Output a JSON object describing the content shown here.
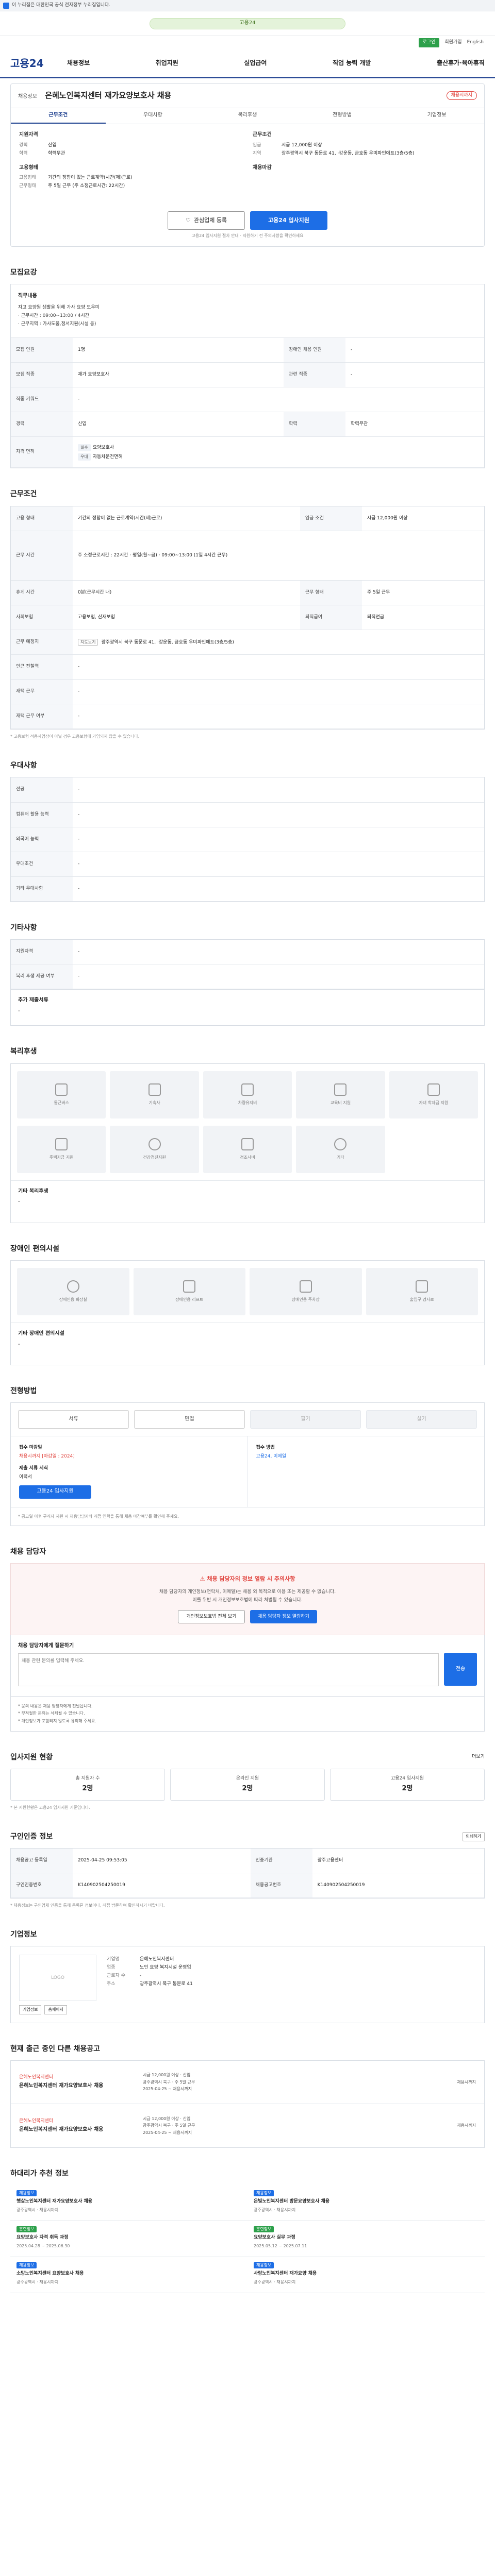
{
  "topbar": {
    "notice": "이 누리집은 대한민국 공식 전자정부 누리집입니다."
  },
  "banner": {
    "text": "고용24"
  },
  "util": {
    "login": "로그인",
    "join": "회원가입",
    "lang": "English"
  },
  "gnb": {
    "logo": "고용24",
    "menu": [
      "채용정보",
      "취업지원",
      "실업급여",
      "직업 능력 개발",
      "출산휴가·육아휴직"
    ]
  },
  "posting": {
    "org": "채용정보",
    "title": "은혜노인복지센터 재가요양보호사 채용",
    "badge": "채용시까지",
    "tabs": [
      "근무조건",
      "우대사항",
      "복리후생",
      "전형방법",
      "기업정보"
    ],
    "summary": {
      "left": [
        {
          "h": "지원자격",
          "rows": [
            [
              "경력",
              "신입"
            ],
            [
              "학력",
              "학력무관"
            ]
          ]
        },
        {
          "h": "고용형태",
          "rows": [
            [
              "고용형태",
              "기간의 정함이 없는 근로계약(시간(제)근로)"
            ],
            [
              "근무형태",
              "주 5일 근무 (주 소정근로시간: 22시간)"
            ]
          ]
        }
      ],
      "right": [
        {
          "h": "근무조건",
          "rows": [
            [
              "임금",
              "시급 12,000원 이상"
            ],
            [
              "지역",
              "광주광역시 북구 동문로 41, ·강운동, 금호동 우미파인에트(3층/5층)"
            ]
          ]
        },
        {
          "h": "채용마감",
          "rows": []
        }
      ]
    },
    "actions": {
      "save": "관심업체 등록",
      "apply": "고용24 입사지원"
    },
    "note": "고용24 입사지원 절차 안내 · 지원하기 전 주의사항을 확인하세요"
  },
  "job": {
    "title": "모집요강",
    "desc_h": "직무내용",
    "desc": [
      "자고 요양원 생활을 위해 가사 요양 도우미",
      "· 근무시간 : 09:00~13:00 / 4시간",
      "· 근무지역 : 가사도움,정서지원(시설 등)"
    ],
    "rows": [
      [
        {
          "k": "모집 인원",
          "v": "1명"
        },
        {
          "k": "장애인 채용 인원",
          "v": "-"
        }
      ],
      [
        {
          "k": "모집 직종",
          "v": "재가 요양보호사"
        },
        {
          "k": "관련 직종",
          "v": "-"
        }
      ],
      [
        {
          "k": "직종 키워드",
          "v": "-"
        },
        {
          "k": "",
          "v": ""
        }
      ],
      [
        {
          "k": "경력",
          "v": "신입"
        },
        {
          "k": "학력",
          "v": "학력무관"
        }
      ],
      [
        {
          "k": "자격 면허",
          "v": "요양보호사"
        },
        {
          "k": "",
          "v": ""
        }
      ]
    ],
    "cert_tags": [
      "필수",
      "우대"
    ],
    "cert_values": [
      "요양보호사",
      "자동차운전면허"
    ]
  },
  "cond": {
    "title": "근무조건",
    "rows": [
      [
        {
          "k": "고용 형태",
          "v": "기간의 정함이 없는 근로계약(시간(제)근로)"
        },
        {
          "k": "임금 조건",
          "v": "시급 12,000원 이상"
        }
      ],
      [
        {
          "k": "근무 시간",
          "v": "주 소정근로시간 : 22시간 · 평일(월~금) · 09:00~13:00 (1일 4시간 근무)"
        },
        {
          "k": "",
          "v": ""
        }
      ],
      [
        {
          "k": "휴게 시간",
          "v": "0분(근무시간 내)"
        },
        {
          "k": "근무 형태",
          "v": "주 5일 근무"
        }
      ],
      [
        {
          "k": "사회보험",
          "v": "고용보험, 산재보험"
        },
        {
          "k": "퇴직급여",
          "v": "퇴직연금"
        }
      ],
      [
        {
          "k": "근무 예정지",
          "v": "광주광역시 북구 동문로 41, ·강운동, 금호동 우미파인에트(3층/5층)"
        },
        {
          "k": "",
          "v": ""
        }
      ],
      [
        {
          "k": "인근 전철역",
          "v": "-"
        },
        {
          "k": "",
          "v": ""
        }
      ],
      [
        {
          "k": "재택 근무",
          "v": "-"
        },
        {
          "k": "",
          "v": ""
        }
      ],
      [
        {
          "k": "재택 근무 여부",
          "v": "-"
        },
        {
          "k": "",
          "v": ""
        }
      ]
    ],
    "map_btn": "지도보기",
    "note": "* 고용보험 적용사업장이 아닐 경우 고용보험에 가입되지 않을 수 있습니다."
  },
  "pref": {
    "title": "우대사항",
    "rows": [
      [
        "전공",
        "-"
      ],
      [
        "컴퓨터 활용 능력",
        "-"
      ],
      [
        "외국어 능력",
        "-"
      ],
      [
        "우대조건",
        "-"
      ],
      [
        "기타 우대사항",
        "-"
      ]
    ]
  },
  "etc": {
    "title": "기타사항",
    "rows": [
      [
        "지원자격",
        "-"
      ],
      [
        "복리 후생 제공 여부",
        "-"
      ]
    ],
    "extra_h": "추가 제출서류",
    "extra_v": "-"
  },
  "welfare": {
    "title": "복리후생",
    "icons1": [
      "통근버스",
      "기숙사",
      "차량유지비",
      "교육비 지원",
      "자녀 학자금 지원"
    ],
    "icons2": [
      "주택자금 지원",
      "건강검진지원",
      "경조사비",
      "기타"
    ],
    "etc_h": "기타 복리후생",
    "etc_v": "-"
  },
  "disab": {
    "title": "장애인 편의시설",
    "icons": [
      "장애인용 화장실",
      "장애인용 리프트",
      "장애인용 주차장",
      "출입구 경사로"
    ],
    "etc_h": "기타 장애인 편의시설",
    "etc_v": "-"
  },
  "sel": {
    "title": "전형방법",
    "steps": [
      "서류",
      "면접",
      "필기",
      "실기"
    ],
    "dim": [
      false,
      false,
      true,
      true
    ],
    "apply_h": "접수 마감일",
    "apply_v": "채용시까지 [마감일 : 2024]",
    "method_h": "접수 방법",
    "method_v": "고용24, 이메일",
    "submit_h": "제출 서류 서식",
    "submit_v": "이력서",
    "apply_btn": "고용24 입사지원",
    "note": "* 공고일 이후 구직자 지원 시 채용담당자와 직접 연락을 통해 채용 마감여부를 확인해 주세요."
  },
  "recruiter": {
    "title": "채용 담당자",
    "warn": "채용 담당자의 정보 열람 시 주의사항",
    "lines": [
      "채용 담당자의 개인정보(연락처, 이메일)는 채용 외 목적으로 이용 또는 제공할 수 없습니다.",
      "이를 위반 시 개인정보보호법에 따라 처벌될 수 있습니다."
    ],
    "btn1": "개인정보보호법 전체 보기",
    "btn2": "채용 담당자 정보 열람하기",
    "inq_h": "채용 담당자에게 질문하기",
    "inq_ph": "채용 관련 문의를 입력해 주세요.",
    "send": "전송",
    "notes": [
      "* 문의 내용은 채용 담당자에게 전달됩니다.",
      "* 부적절한 문의는 삭제될 수 있습니다.",
      "* 개인정보가 포함되지 않도록 유의해 주세요."
    ]
  },
  "status": {
    "title": "입사지원 현황",
    "more": "더보기",
    "cards": [
      {
        "l": "총 지원자 수",
        "v": "2명"
      },
      {
        "l": "온라인 지원",
        "v": "2명"
      },
      {
        "l": "고용24 입사지원",
        "v": "2명"
      }
    ],
    "note": "* 본 지원현황은 고용24 입사지원 기준입니다."
  },
  "info": {
    "title": "구인인증 정보",
    "btn": "인쇄하기",
    "rows": [
      [
        {
          "k": "채용공고 등록일",
          "v": "2025-04-25 09:53:05"
        },
        {
          "k": "인증기관",
          "v": "광주고용센터"
        }
      ],
      [
        {
          "k": "구인인증번호",
          "v": "K140902504250019"
        },
        {
          "k": "채용공고번호",
          "v": "K140902504250019"
        }
      ]
    ],
    "note": "* 채용정보는 구인업체 인증을 통해 등록된 정보이나, 직접 방문하여 확인하시기 바랍니다."
  },
  "company": {
    "title": "기업정보",
    "logo": "LOGO",
    "rows": [
      [
        "기업명",
        "은혜노인복지센터"
      ],
      [
        "업종",
        "노인 요양 복지시설 운영업"
      ],
      [
        "근로자 수",
        "-"
      ],
      [
        "주소",
        "광주광역시 북구 동문로 41"
      ]
    ],
    "btn1": "기업정보",
    "btn2": "홈페이지"
  },
  "similar": {
    "title": "현재 출근 중인 다른 채용공고",
    "jobs": [
      {
        "org": "은혜노인복지센터",
        "title": "은혜노인복지센터 재가요양보호사 채용",
        "m": [
          "시급 12,000원 이상 · 신입",
          "광주광역시 북구 · 주 5일 근무",
          "2025-04-25 ~ 채용시까지"
        ],
        "d": "채용시까지"
      },
      {
        "org": "은혜노인복지센터",
        "title": "은혜노인복지센터 재가요양보호사 채용",
        "m": [
          "시급 12,000원 이상 · 신입",
          "광주광역시 북구 · 주 5일 근무",
          "2025-04-25 ~ 채용시까지"
        ],
        "d": "채용시까지"
      }
    ]
  },
  "news": {
    "title": "하대리가 추천 정보",
    "items": [
      {
        "lab": "채용정보",
        "green": false,
        "t": "햇살노인복지센터 재가요양보호사 채용",
        "m": "광주광역시 · 채용시까지"
      },
      {
        "lab": "채용정보",
        "green": false,
        "t": "은빛노인복지센터 방문요양보호사 채용",
        "m": "광주광역시 · 채용시까지"
      },
      {
        "lab": "훈련정보",
        "green": true,
        "t": "요양보호사 자격 취득 과정",
        "m": "2025.04.28 ~ 2025.06.30"
      },
      {
        "lab": "훈련정보",
        "green": true,
        "t": "요양보호사 실무 과정",
        "m": "2025.05.12 ~ 2025.07.11"
      },
      {
        "lab": "채용정보",
        "green": false,
        "t": "소망노인복지센터 요양보호사 채용",
        "m": "광주광역시 · 채용시까지"
      },
      {
        "lab": "채용정보",
        "green": false,
        "t": "사랑노인복지센터 재가요양 채용",
        "m": "광주광역시 · 채용시까지"
      }
    ]
  }
}
